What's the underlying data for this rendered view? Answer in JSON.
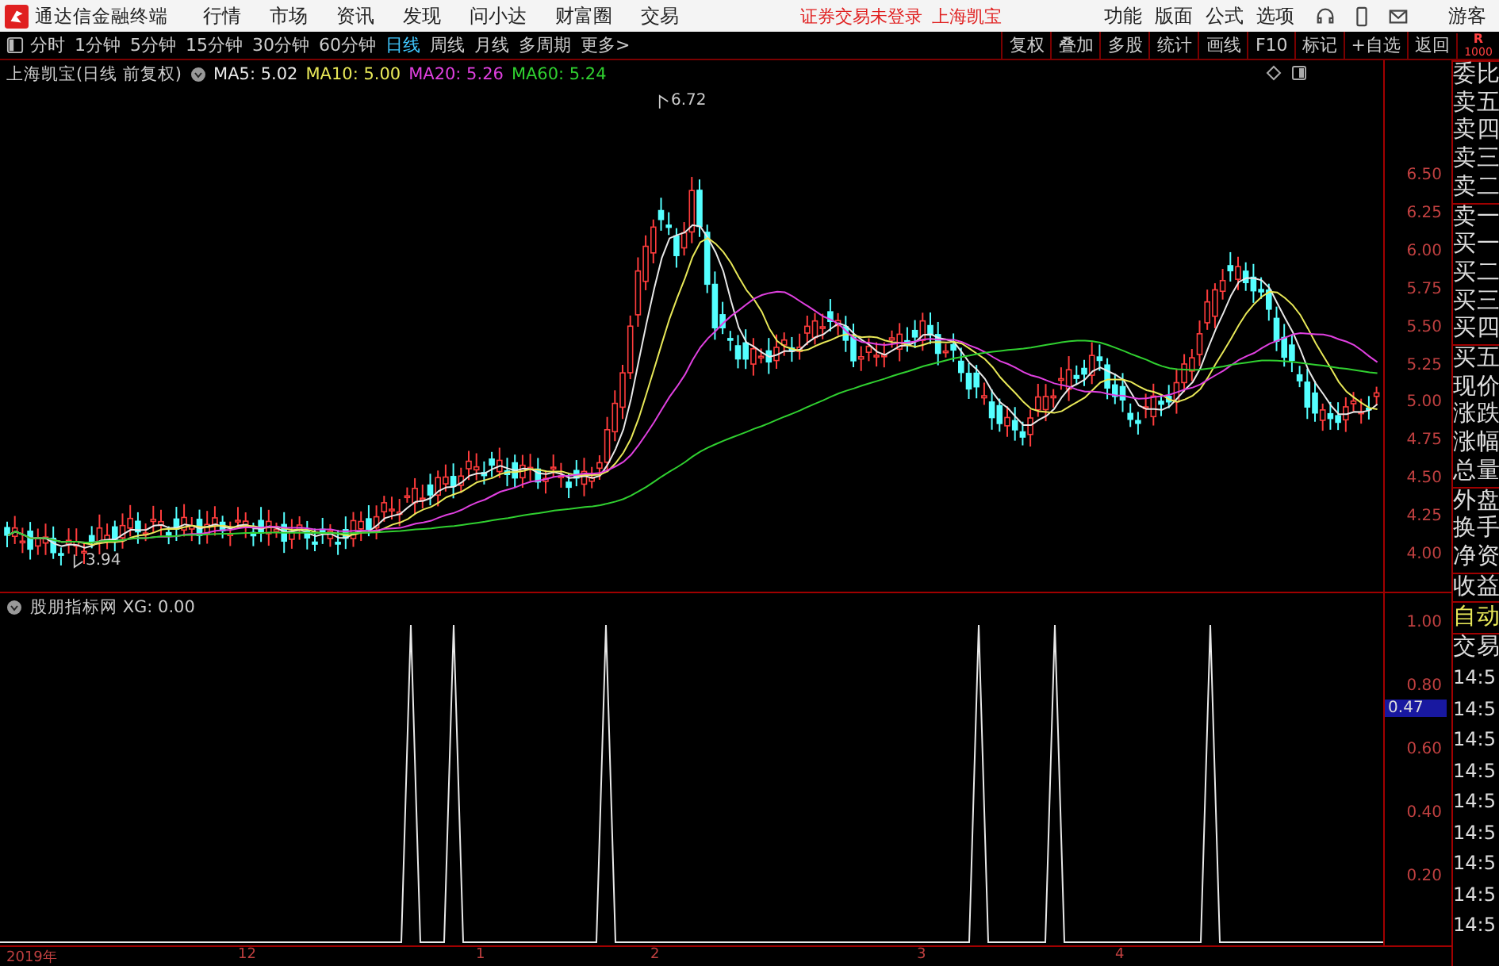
{
  "menu_bar": {
    "app_title": "通达信金融终端",
    "items": [
      "行情",
      "市场",
      "资讯",
      "发现",
      "问小达",
      "财富圈",
      "交易"
    ],
    "notices": [
      "证券交易未登录",
      "上海凯宝"
    ],
    "right_items": [
      "功能",
      "版面",
      "公式",
      "选项"
    ],
    "user": "游客"
  },
  "toolbar": {
    "periods": [
      {
        "label": "分时",
        "selected": false
      },
      {
        "label": "1分钟",
        "selected": false
      },
      {
        "label": "5分钟",
        "selected": false
      },
      {
        "label": "15分钟",
        "selected": false
      },
      {
        "label": "30分钟",
        "selected": false
      },
      {
        "label": "60分钟",
        "selected": false
      },
      {
        "label": "日线",
        "selected": true
      },
      {
        "label": "周线",
        "selected": false
      },
      {
        "label": "月线",
        "selected": false
      },
      {
        "label": "多周期",
        "selected": false
      },
      {
        "label": "更多>",
        "selected": false
      }
    ],
    "buttons": [
      "复权",
      "叠加",
      "多股",
      "统计",
      "画线",
      "F10",
      "标记",
      "+自选",
      "返回"
    ],
    "corner": [
      "R",
      "1000"
    ]
  },
  "price_chart": {
    "title": "上海凯宝(日线 前复权)",
    "ma_legend": [
      {
        "label": "MA5: 5.02",
        "color": "#e8e8e8"
      },
      {
        "label": "MA10: 5.00",
        "color": "#e8e858"
      },
      {
        "label": "MA20: 5.26",
        "color": "#e040e0"
      },
      {
        "label": "MA60: 5.24",
        "color": "#30d030"
      }
    ],
    "high_label": "6.72",
    "low_label": "3.94",
    "axis_ticks": [
      "6.50",
      "6.25",
      "6.00",
      "5.75",
      "5.50",
      "5.25",
      "5.00",
      "4.75",
      "4.50",
      "4.25",
      "4.00"
    ]
  },
  "indicator": {
    "title": "股朋指标网 XG: 0.00",
    "axis_ticks": [
      "1.00",
      "0.80",
      "0.60",
      "0.40",
      "0.20"
    ],
    "cursor_value": "0.47"
  },
  "date_axis": [
    "2019年",
    "12",
    "1",
    "2",
    "3",
    "4"
  ],
  "quote_panel": {
    "labels": [
      "委比",
      "卖五",
      "卖四",
      "卖三",
      "卖二",
      "卖一",
      "买一",
      "买二",
      "买三",
      "买四",
      "买五",
      "现价",
      "涨跌",
      "涨幅",
      "总量",
      "外盘",
      "换手",
      "净资",
      "收益"
    ],
    "mode": "自动",
    "trades_header": "交易",
    "times": [
      "14:5",
      "14:5",
      "14:5",
      "14:5",
      "14:5",
      "14:5",
      "14:5",
      "14:5",
      "14:5"
    ]
  }
}
